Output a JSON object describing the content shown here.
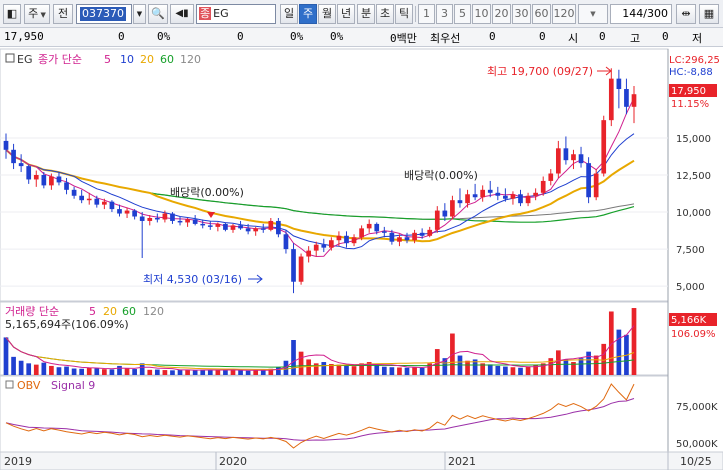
{
  "toolbar": {
    "type_label": "주",
    "before_label": "전",
    "code": "037370",
    "name_prefix": "종",
    "name": "EG",
    "periods": [
      "일",
      "주",
      "월",
      "년",
      "분",
      "초",
      "틱"
    ],
    "active_period": "주",
    "intervals": [
      "1",
      "3",
      "5",
      "10",
      "20",
      "30",
      "60",
      "120"
    ],
    "count": "144",
    "count_total": "/300"
  },
  "info_row": {
    "price": "17,950",
    "v1": "0",
    "v2": "0%",
    "v3": "0",
    "v4": "0%",
    "v5": "0%",
    "amount": "0백만",
    "label_best": "최우선",
    "v6": "0",
    "v7": "0",
    "label_open": "시",
    "v8": "0",
    "label_high": "고",
    "v9": "0",
    "label_low": "저"
  },
  "price_panel": {
    "legend_code": "EG",
    "legend_label": "종가 단순",
    "ma_periods": [
      "5",
      "10",
      "20",
      "60",
      "120"
    ],
    "lc_label": "LC:296,25",
    "hc_label": "HC:-8,88",
    "last_price": "17,950",
    "last_pct": "11.15%",
    "high_annotation": "최고 19,700 (09/27)",
    "low_annotation": "최저 4,530 (03/16)",
    "dividend_annotation_1": "배당락(0.00%)",
    "dividend_annotation_2": "배당락(0.00%)",
    "y_ticks": [
      "15,000",
      "12,500",
      "10,000",
      "7,500",
      "5,000"
    ]
  },
  "volume_panel": {
    "legend_label": "거래량 단순",
    "ma_periods": [
      "5",
      "20",
      "60",
      "120"
    ],
    "volume_info": "5,165,694주(106.09%)",
    "last_volume": "5,166K",
    "last_volume_pct": "106.09%"
  },
  "obv_panel": {
    "legend_obv": "OBV",
    "legend_signal": "Signal 9",
    "y_ticks": [
      "75,000K",
      "50,000K"
    ]
  },
  "x_axis": {
    "labels": [
      "2019",
      "2020",
      "2021",
      "10/25"
    ]
  },
  "colors": {
    "up": "#e8232a",
    "down": "#1f3fd0",
    "ma5": "#d0208f",
    "ma10": "#1f3fd0",
    "ma20": "#e8a800",
    "ma60": "#17a02a",
    "ma120": "#7a7a7a",
    "obv": "#e06a10",
    "signal": "#9a2fa8",
    "active_tab": "#2f6fc9"
  },
  "chart_data": {
    "type": "candlestick",
    "period": "weekly",
    "x_range": [
      "2018-10",
      "2021-10-25"
    ],
    "y_range": [
      4000,
      21000
    ],
    "price_markers": {
      "high": 19700,
      "low": 4530,
      "last": 17950
    },
    "candles": [
      [
        14800,
        15300,
        13600,
        14200
      ],
      [
        14200,
        14600,
        12900,
        13300
      ],
      [
        13300,
        13900,
        12700,
        13100
      ],
      [
        13100,
        13200,
        11900,
        12200
      ],
      [
        12200,
        12800,
        11700,
        12500
      ],
      [
        12500,
        12700,
        11600,
        11800
      ],
      [
        11800,
        12600,
        11500,
        12400
      ],
      [
        12400,
        12700,
        11800,
        12000
      ],
      [
        12000,
        12300,
        11200,
        11500
      ],
      [
        11500,
        11700,
        10900,
        11100
      ],
      [
        11100,
        11500,
        10600,
        10800
      ],
      [
        10800,
        11300,
        10500,
        10900
      ],
      [
        10900,
        11100,
        10300,
        10500
      ],
      [
        10500,
        10900,
        10200,
        10700
      ],
      [
        10700,
        10800,
        10000,
        10200
      ],
      [
        10200,
        10500,
        9700,
        9900
      ],
      [
        9900,
        10300,
        9600,
        10100
      ],
      [
        10100,
        10200,
        9500,
        9700
      ],
      [
        9700,
        10000,
        6900,
        9400
      ],
      [
        9400,
        9800,
        9100,
        9600
      ],
      [
        9600,
        9900,
        9300,
        9500
      ],
      [
        9500,
        10100,
        9300,
        9900
      ],
      [
        9900,
        10000,
        9200,
        9400
      ],
      [
        9400,
        9700,
        9100,
        9300
      ],
      [
        9300,
        9600,
        9000,
        9500
      ],
      [
        9500,
        9800,
        9100,
        9200
      ],
      [
        9200,
        9500,
        8900,
        9100
      ],
      [
        9100,
        9400,
        8800,
        9000
      ],
      [
        9000,
        9300,
        8700,
        9200
      ],
      [
        9200,
        9300,
        8700,
        8800
      ],
      [
        8800,
        9200,
        8600,
        9100
      ],
      [
        9100,
        9400,
        8800,
        8900
      ],
      [
        8900,
        9200,
        8500,
        8700
      ],
      [
        8700,
        9000,
        8400,
        8900
      ],
      [
        8900,
        9200,
        8600,
        8800
      ],
      [
        8800,
        9600,
        8700,
        9400
      ],
      [
        9400,
        9600,
        8300,
        8500
      ],
      [
        8500,
        8800,
        7200,
        7500
      ],
      [
        7500,
        7900,
        4530,
        5300
      ],
      [
        5300,
        7200,
        5100,
        7000
      ],
      [
        7000,
        7700,
        6600,
        7400
      ],
      [
        7400,
        8000,
        7000,
        7800
      ],
      [
        7800,
        8200,
        7300,
        7600
      ],
      [
        7600,
        8300,
        7400,
        8100
      ],
      [
        8100,
        8700,
        7700,
        8400
      ],
      [
        8400,
        8700,
        7600,
        7900
      ],
      [
        7900,
        8500,
        7700,
        8300
      ],
      [
        8300,
        9100,
        8100,
        8900
      ],
      [
        8900,
        9500,
        8600,
        9200
      ],
      [
        9200,
        9300,
        8500,
        8700
      ],
      [
        8700,
        9000,
        8300,
        8600
      ],
      [
        8600,
        8800,
        7800,
        8000
      ],
      [
        8000,
        8500,
        7700,
        8300
      ],
      [
        8300,
        8600,
        7900,
        8100
      ],
      [
        8100,
        8800,
        7900,
        8600
      ],
      [
        8600,
        8900,
        8200,
        8400
      ],
      [
        8400,
        9000,
        8300,
        8800
      ],
      [
        8800,
        10400,
        8600,
        10100
      ],
      [
        10100,
        10600,
        9400,
        9700
      ],
      [
        9700,
        11100,
        9500,
        10800
      ],
      [
        10800,
        11600,
        10300,
        10600
      ],
      [
        10600,
        11500,
        10300,
        11200
      ],
      [
        11200,
        11900,
        10800,
        11000
      ],
      [
        11000,
        11800,
        10700,
        11500
      ],
      [
        11500,
        12100,
        11000,
        11300
      ],
      [
        11300,
        11700,
        10800,
        11100
      ],
      [
        11100,
        11600,
        10700,
        10900
      ],
      [
        10900,
        11400,
        10500,
        11200
      ],
      [
        11200,
        11500,
        10400,
        10600
      ],
      [
        10600,
        11300,
        10400,
        11100
      ],
      [
        11100,
        11600,
        10800,
        11300
      ],
      [
        11300,
        12400,
        11100,
        12100
      ],
      [
        12100,
        12900,
        11800,
        12600
      ],
      [
        12600,
        14800,
        12300,
        14300
      ],
      [
        14300,
        15100,
        13200,
        13500
      ],
      [
        13500,
        14200,
        12900,
        13900
      ],
      [
        13900,
        14400,
        13000,
        13300
      ],
      [
        13300,
        13700,
        10600,
        11000
      ],
      [
        11000,
        12900,
        10800,
        12600
      ],
      [
        12600,
        16500,
        12400,
        16200
      ],
      [
        16200,
        19700,
        15800,
        19000
      ],
      [
        19000,
        19600,
        17000,
        18300
      ],
      [
        18300,
        19000,
        16600,
        17100
      ],
      [
        17100,
        18500,
        16000,
        17950
      ]
    ],
    "volume": [
      2900,
      1400,
      1100,
      900,
      800,
      950,
      700,
      600,
      650,
      500,
      480,
      550,
      520,
      450,
      430,
      700,
      500,
      460,
      900,
      400,
      420,
      380,
      360,
      400,
      390,
      370,
      410,
      380,
      360,
      420,
      390,
      350,
      330,
      360,
      380,
      480,
      600,
      1100,
      2700,
      1800,
      1200,
      900,
      1000,
      850,
      800,
      700,
      680,
      900,
      1000,
      760,
      640,
      600,
      580,
      560,
      620,
      540,
      900,
      2000,
      1300,
      3200,
      1500,
      1100,
      1200,
      900,
      820,
      700,
      650,
      600,
      560,
      640,
      780,
      900,
      1300,
      1900,
      1200,
      1000,
      1300,
      1800,
      1500,
      2400,
      4900,
      3500,
      3100,
      5166
    ],
    "obv_range_k": [
      45000,
      85000
    ],
    "obv_ticks_k": [
      50000,
      75000
    ],
    "y_ticks": [
      5000,
      7500,
      10000,
      12500,
      15000
    ]
  }
}
